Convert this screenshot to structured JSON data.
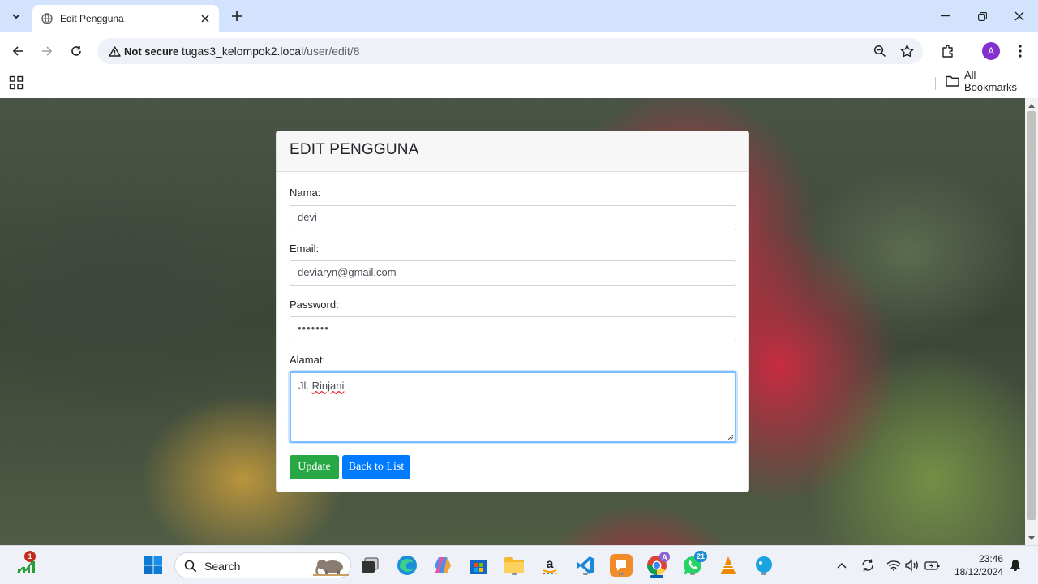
{
  "browser": {
    "tab_title": "Edit Pengguna",
    "security_label": "Not secure",
    "url_host": "tugas3_kelompok2.local",
    "url_path": "/user/edit/8",
    "profile_initial": "A",
    "all_bookmarks": "All Bookmarks"
  },
  "form": {
    "heading": "EDIT PENGGUNA",
    "nama_label": "Nama:",
    "nama_value": "devi",
    "email_label": "Email:",
    "email_value": "deviaryn@gmail.com",
    "password_label": "Password:",
    "password_value": "•••••••",
    "alamat_label": "Alamat:",
    "alamat_prefix": "Jl.",
    "alamat_word": "Rinjani",
    "update_button": "Update",
    "back_button": "Back to List"
  },
  "taskbar": {
    "search_placeholder": "Search",
    "widget_badge": "1",
    "chrome_badge": "A",
    "whatsapp_badge": "21",
    "time": "23:46",
    "date": "18/12/2024"
  },
  "colors": {
    "update_button": "#28a745",
    "back_button": "#007bff",
    "tab_strip": "#d3e3fd",
    "profile": "#8430ce"
  }
}
